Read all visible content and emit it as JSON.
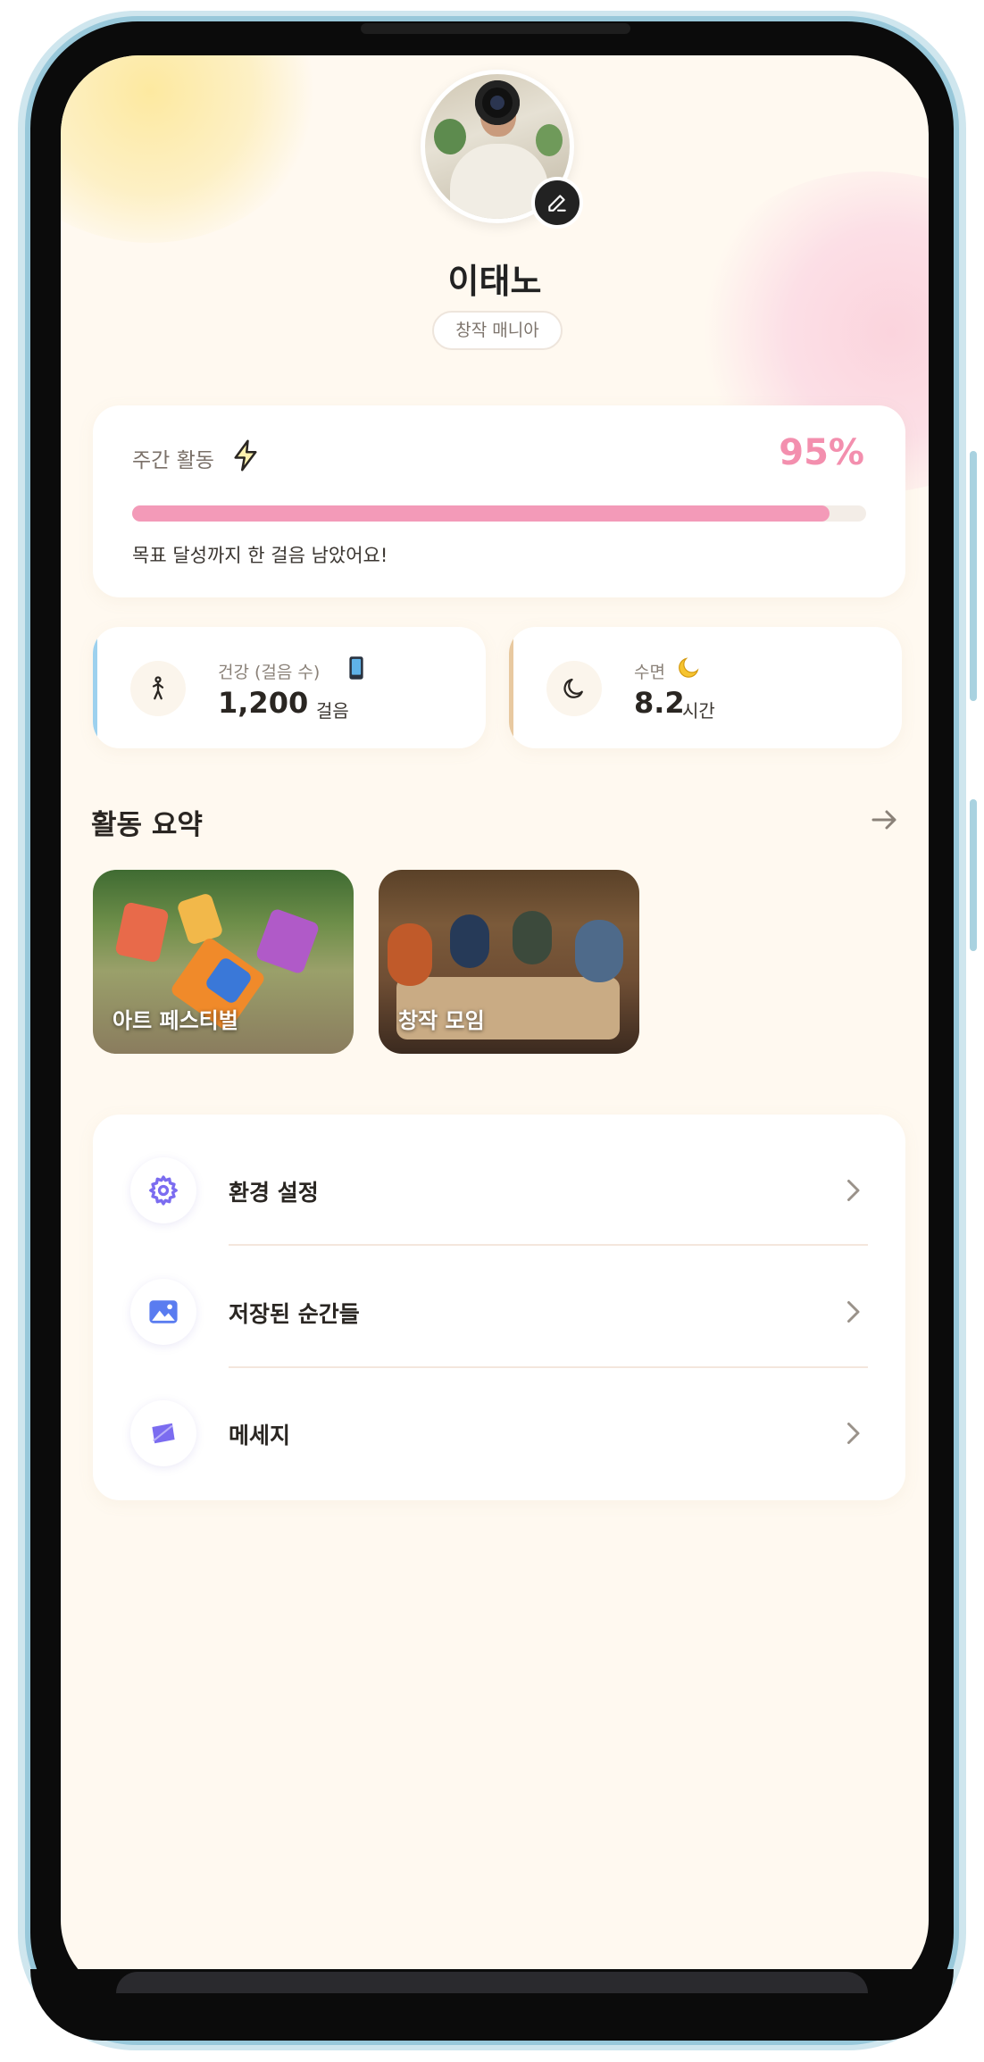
{
  "profile": {
    "name": "이태노",
    "tag": "창작 매니아"
  },
  "weekly": {
    "label": "주간 활동",
    "percent_text": "95%",
    "progress": 0.95,
    "message": "목표 달성까지 한 걸음 남았어요!"
  },
  "stats": {
    "health": {
      "label": "건강 (걸음 수)",
      "value": "1,200",
      "unit": "걸음",
      "accent": "#9dd1ee"
    },
    "sleep": {
      "label": "수면",
      "value": "8.2",
      "unit": "시간",
      "accent": "#e8c9a0"
    }
  },
  "activity": {
    "title": "활동 요약",
    "items": [
      {
        "label": "아트 페스티벌"
      },
      {
        "label": "창작 모임"
      }
    ]
  },
  "menu": {
    "items": [
      {
        "label": "환경 설정",
        "icon": "gear-icon"
      },
      {
        "label": "저장된 순간들",
        "icon": "image-icon"
      },
      {
        "label": "메세지",
        "icon": "message-icon"
      }
    ]
  },
  "colors": {
    "accent_pink": "#f38fae",
    "background": "#fff9f0",
    "icon_purple": "#7b6cf0"
  }
}
